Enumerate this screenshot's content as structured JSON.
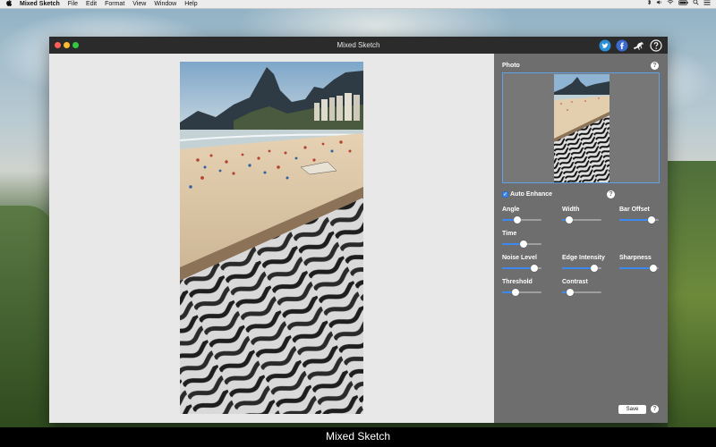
{
  "menubar": {
    "apple_icon": "apple-icon",
    "items": [
      "Mixed Sketch",
      "File",
      "Edit",
      "Format",
      "View",
      "Window",
      "Help"
    ]
  },
  "window": {
    "title": "Mixed Sketch",
    "toolbar_icons": [
      "twitter-icon",
      "facebook-icon",
      "horse-icon",
      "help-icon"
    ]
  },
  "panel": {
    "photo_label": "Photo",
    "auto_enhance_label": "Auto Enhance",
    "auto_enhance_checked": true,
    "sliders": {
      "angle": {
        "label": "Angle",
        "value": 0.35
      },
      "width": {
        "label": "Width",
        "value": 0.1
      },
      "bar_offset": {
        "label": "Bar Offset",
        "value": 0.9
      },
      "time": {
        "label": "Time",
        "value": 0.55
      },
      "noise_level": {
        "label": "Noise Level",
        "value": 0.9
      },
      "edge_intensity": {
        "label": "Edge Intensity",
        "value": 0.9
      },
      "sharpness": {
        "label": "Sharpness",
        "value": 0.95
      },
      "threshold": {
        "label": "Threshold",
        "value": 0.3
      },
      "contrast": {
        "label": "Contrast",
        "value": 0.15
      }
    },
    "save_label": "Save"
  },
  "caption": "Mixed Sketch",
  "colors": {
    "accent": "#3c8af0",
    "panel_bg": "#6e6e6e",
    "titlebar_bg": "#2b2b2b"
  }
}
